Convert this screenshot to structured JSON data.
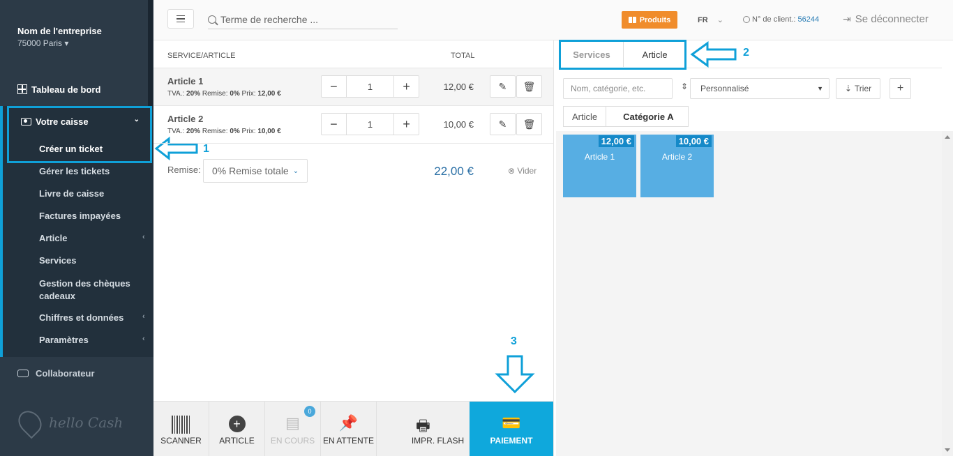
{
  "sidebar": {
    "company_name": "Nom de l'entreprise",
    "company_city": "75000 Paris",
    "dashboard": "Tableau de bord",
    "register": "Votre caisse",
    "items": [
      {
        "label": "Créer un ticket"
      },
      {
        "label": "Gérer les tickets"
      },
      {
        "label": "Livre de caisse"
      },
      {
        "label": "Factures impayées"
      },
      {
        "label": "Article"
      },
      {
        "label": "Services"
      },
      {
        "label": "Gestion des chèques cadeaux"
      },
      {
        "label": "Chiffres et données"
      },
      {
        "label": "Paramètres"
      }
    ],
    "collaborator": "Collaborateur",
    "logo_text": "hello Cash"
  },
  "topbar": {
    "search_placeholder": "Terme de recherche ...",
    "products_label": "Produits",
    "language": "FR",
    "client_label": "N° de client.:",
    "client_number": "56244",
    "logout": "Se déconnecter"
  },
  "ticket": {
    "col_item": "SERVICE/ARTICLE",
    "col_total": "TOTAL",
    "rows": [
      {
        "name": "Article 1",
        "tva_label": "TVA.:",
        "tva": "20%",
        "remise_label": "Remise:",
        "remise": "0%",
        "prix_label": "Prix:",
        "prix": "12,00 €",
        "qty": "1",
        "total": "12,00 €"
      },
      {
        "name": "Article 2",
        "tva_label": "TVA.:",
        "tva": "20%",
        "remise_label": "Remise:",
        "remise": "0%",
        "prix_label": "Prix:",
        "prix": "10,00 €",
        "qty": "1",
        "total": "10,00 €"
      }
    ],
    "remise_label": "Remise:",
    "remise_value": "0% Remise totale",
    "grand_total": "22,00 €",
    "clear": "Vider"
  },
  "toolbar": {
    "scanner": "SCANNER",
    "article": "ARTICLE",
    "en_cours": "EN COURS",
    "en_cours_count": "0",
    "en_attente": "EN ATTENTE",
    "impr_flash": "IMPR. FLASH",
    "paiement": "PAIEMENT"
  },
  "right": {
    "tabs": [
      {
        "label": "Services"
      },
      {
        "label": "Article"
      }
    ],
    "filter_placeholder": "Nom, catégorie, etc.",
    "sort_select": "Personnalisé",
    "sort_button": "Trier",
    "breadcrumb": [
      "Article",
      "Catégorie A"
    ],
    "products": [
      {
        "name": "Article 1",
        "price": "12,00 €"
      },
      {
        "name": "Article 2",
        "price": "10,00 €"
      }
    ]
  },
  "annotations": {
    "n1": "1",
    "n2": "2",
    "n3": "3"
  },
  "colors": {
    "accent": "#0fa0d8",
    "sidebar": "#2c3a47",
    "produits": "#f08c2b",
    "product_card": "#57aee3",
    "pay": "#0fa8dc"
  }
}
